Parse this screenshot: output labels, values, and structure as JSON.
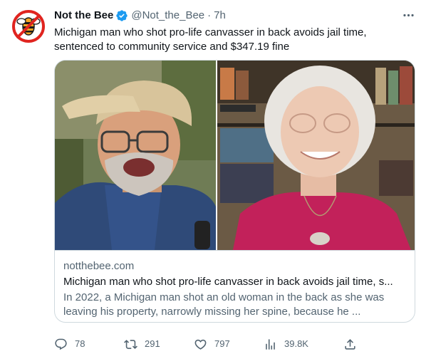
{
  "tweet": {
    "display_name": "Not the Bee",
    "handle": "@Not_the_Bee",
    "separator": "·",
    "time": "7h",
    "text": "Michigan man who shot pro-life canvasser in back avoids jail time, sentenced to community service and $347.19 fine",
    "avatar_icon": "not-the-bee-logo",
    "verified_icon": "verified-badge-icon",
    "verified_color": "#1d9bf0"
  },
  "card": {
    "domain": "notthebee.com",
    "title": "Michigan man who shot pro-life canvasser in back avoids jail time, s...",
    "description": "In 2022, a Michigan man shot an old woman in the back as she was leaving his property, narrowly missing her spine, because he ..."
  },
  "actions": {
    "replies": "78",
    "retweets": "291",
    "likes": "797",
    "views": "39.8K"
  },
  "colors": {
    "text_primary": "#0f1419",
    "text_secondary": "#536471",
    "border": "#cfd9de",
    "logo_red": "#e0241f",
    "logo_gold": "#f5a623"
  }
}
